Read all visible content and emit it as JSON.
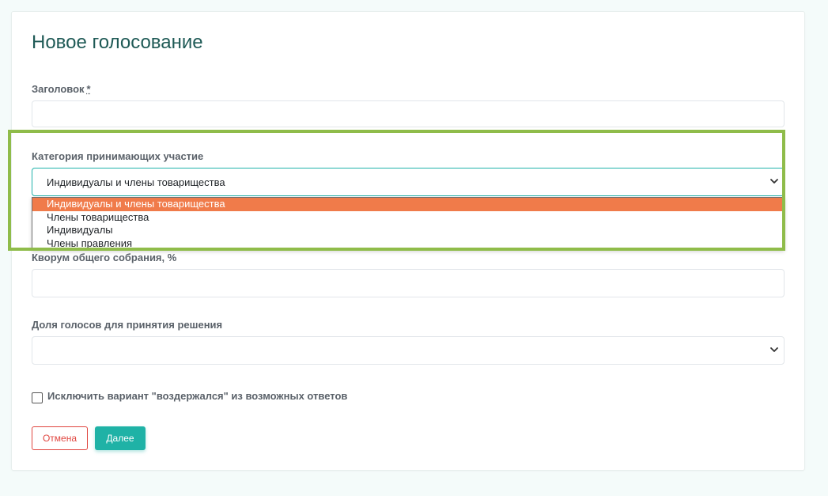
{
  "page": {
    "title": "Новое голосование"
  },
  "form": {
    "title_field": {
      "label": "Заголовок",
      "required_mark": "*",
      "value": ""
    },
    "category_field": {
      "label": "Категория принимающих участие",
      "value": "Индивидуалы и члены товарищества",
      "options": [
        "Индивидуалы и члены товарищества",
        "Члены товарищества",
        "Индивидуалы",
        "Члены правления"
      ],
      "selected_index": 0
    },
    "quorum_field": {
      "label": "Кворум общего собрания, %",
      "value": ""
    },
    "vote_share_field": {
      "label": "Доля голосов для принятия решения",
      "value": ""
    },
    "exclude_abstain": {
      "label": "Исключить вариант \"воздержался\" из возможных ответов",
      "checked": false
    }
  },
  "buttons": {
    "cancel": "Отмена",
    "next": "Далее"
  },
  "colors": {
    "accent": "#1fb2a6",
    "title": "#1f5a56",
    "cancel": "#e0453f",
    "option_selected": "#f07b4a",
    "highlight_frame": "#8fbc4a"
  },
  "icons": {
    "select_arrow": "chevron-down-icon"
  }
}
